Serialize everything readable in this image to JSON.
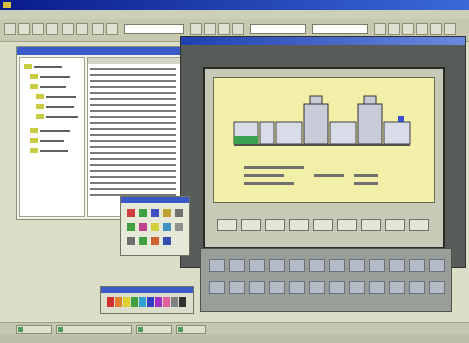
{
  "window": {
    "title": "",
    "accent": "#0a1b8a"
  },
  "menu": {
    "items": []
  },
  "taskbar": {
    "tasks": [
      {
        "label": "",
        "icon": "window-icon"
      },
      {
        "label": "",
        "icon": "window-icon"
      },
      {
        "label": "",
        "icon": "window-icon"
      },
      {
        "label": "",
        "icon": "window-icon"
      }
    ]
  },
  "statusbar": {
    "text": ""
  },
  "notes": {
    "screen_text_legibility": "unreadable"
  }
}
